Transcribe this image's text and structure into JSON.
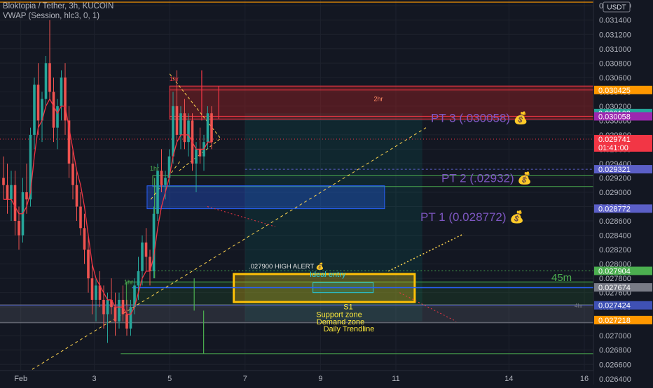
{
  "header": {
    "symbol_line": "Bloktopia / Tether, 3h, KUCOIN",
    "indicator_line": "VWAP (Session, hlc3, 0, 1)"
  },
  "chart_data": {
    "type": "candlestick",
    "title": "Bloktopia / Tether, 3h, KUCOIN",
    "ylim": [
      0.02632,
      0.03168
    ],
    "currency_label": "USDT",
    "y_ticks": [
      0.0316,
      0.0314,
      0.0312,
      0.031,
      0.0308,
      0.0306,
      0.0304,
      0.0302,
      0.03,
      0.0298,
      0.0296,
      0.0294,
      0.0292,
      0.029,
      0.0288,
      0.0286,
      0.0284,
      0.0282,
      0.028,
      0.0278,
      0.0276,
      0.0274,
      0.0272,
      0.027,
      0.0268,
      0.0266,
      0.0264
    ],
    "x_ticks": [
      {
        "label": "Feb",
        "day": 1.05
      },
      {
        "label": "3",
        "day": 3
      },
      {
        "label": "5",
        "day": 5
      },
      {
        "label": "7",
        "day": 7
      },
      {
        "label": "9",
        "day": 9
      },
      {
        "label": "11",
        "day": 11
      },
      {
        "label": "14",
        "day": 14
      },
      {
        "label": "16",
        "day": 16
      }
    ],
    "price_tags": [
      {
        "value": 0.030425,
        "label": "0.030425",
        "color": "#ff9800"
      },
      {
        "value": 0.030103,
        "label": "0.030103",
        "color": "#26a69a"
      },
      {
        "value": 0.030058,
        "label": "0.030058",
        "color": "#9c27b0"
      },
      {
        "value": 0.029741,
        "label": "0.029741",
        "sub": "01:41:00",
        "color": "#f23645"
      },
      {
        "value": 0.029321,
        "label": "0.029321",
        "color": "#5b5fc7"
      },
      {
        "value": 0.028772,
        "label": "0.028772",
        "color": "#5b5fc7"
      },
      {
        "value": 0.027904,
        "label": "0.027904",
        "color": "#4caf50"
      },
      {
        "value": 0.027674,
        "label": "0.027674",
        "color": "#787b86"
      },
      {
        "value": 0.027424,
        "label": "0.027424",
        "color": "#3f51b5"
      },
      {
        "value": 0.027218,
        "label": "0.027218",
        "color": "#ff9800"
      }
    ],
    "candles": [
      {
        "o": 0.0292,
        "h": 0.0295,
        "l": 0.0289,
        "c": 0.0291
      },
      {
        "o": 0.0291,
        "h": 0.0294,
        "l": 0.0287,
        "c": 0.0289
      },
      {
        "o": 0.0289,
        "h": 0.0293,
        "l": 0.0286,
        "c": 0.0291
      },
      {
        "o": 0.0291,
        "h": 0.0293,
        "l": 0.0284,
        "c": 0.0286
      },
      {
        "o": 0.0286,
        "h": 0.0288,
        "l": 0.0282,
        "c": 0.0284
      },
      {
        "o": 0.0284,
        "h": 0.0292,
        "l": 0.0283,
        "c": 0.029
      },
      {
        "o": 0.029,
        "h": 0.0294,
        "l": 0.0287,
        "c": 0.0289
      },
      {
        "o": 0.0289,
        "h": 0.0299,
        "l": 0.0288,
        "c": 0.0298
      },
      {
        "o": 0.0298,
        "h": 0.0306,
        "l": 0.0296,
        "c": 0.0305
      },
      {
        "o": 0.0305,
        "h": 0.0308,
        "l": 0.0298,
        "c": 0.03
      },
      {
        "o": 0.03,
        "h": 0.0304,
        "l": 0.0297,
        "c": 0.0303
      },
      {
        "o": 0.0303,
        "h": 0.0309,
        "l": 0.0302,
        "c": 0.0308
      },
      {
        "o": 0.0308,
        "h": 0.0314,
        "l": 0.0303,
        "c": 0.0304
      },
      {
        "o": 0.0304,
        "h": 0.0306,
        "l": 0.0297,
        "c": 0.0299
      },
      {
        "o": 0.0299,
        "h": 0.0303,
        "l": 0.0296,
        "c": 0.0302
      },
      {
        "o": 0.0302,
        "h": 0.0307,
        "l": 0.03,
        "c": 0.0306
      },
      {
        "o": 0.0306,
        "h": 0.0308,
        "l": 0.0298,
        "c": 0.03
      },
      {
        "o": 0.03,
        "h": 0.0302,
        "l": 0.0292,
        "c": 0.0294
      },
      {
        "o": 0.0294,
        "h": 0.0296,
        "l": 0.0289,
        "c": 0.0291
      },
      {
        "o": 0.0291,
        "h": 0.0293,
        "l": 0.0286,
        "c": 0.0288
      },
      {
        "o": 0.0288,
        "h": 0.029,
        "l": 0.0284,
        "c": 0.0285
      },
      {
        "o": 0.0285,
        "h": 0.0287,
        "l": 0.028,
        "c": 0.0282
      },
      {
        "o": 0.0282,
        "h": 0.0284,
        "l": 0.0276,
        "c": 0.0278
      },
      {
        "o": 0.0278,
        "h": 0.028,
        "l": 0.0273,
        "c": 0.0275
      },
      {
        "o": 0.0275,
        "h": 0.0278,
        "l": 0.0272,
        "c": 0.0277
      },
      {
        "o": 0.0277,
        "h": 0.0279,
        "l": 0.0274,
        "c": 0.0275
      },
      {
        "o": 0.0275,
        "h": 0.0277,
        "l": 0.0271,
        "c": 0.0273
      },
      {
        "o": 0.0273,
        "h": 0.0276,
        "l": 0.0269,
        "c": 0.0275
      },
      {
        "o": 0.0275,
        "h": 0.0278,
        "l": 0.0273,
        "c": 0.0274
      },
      {
        "o": 0.0274,
        "h": 0.0276,
        "l": 0.027,
        "c": 0.0272
      },
      {
        "o": 0.0272,
        "h": 0.0276,
        "l": 0.0271,
        "c": 0.0275
      },
      {
        "o": 0.0275,
        "h": 0.0277,
        "l": 0.0272,
        "c": 0.0273
      },
      {
        "o": 0.0273,
        "h": 0.0275,
        "l": 0.027,
        "c": 0.0271
      },
      {
        "o": 0.0271,
        "h": 0.0275,
        "l": 0.027,
        "c": 0.0274
      },
      {
        "o": 0.0274,
        "h": 0.0278,
        "l": 0.0273,
        "c": 0.0277
      },
      {
        "o": 0.0277,
        "h": 0.0281,
        "l": 0.0275,
        "c": 0.0279
      },
      {
        "o": 0.0279,
        "h": 0.0284,
        "l": 0.0277,
        "c": 0.0283
      },
      {
        "o": 0.0283,
        "h": 0.0285,
        "l": 0.0279,
        "c": 0.0281
      },
      {
        "o": 0.0281,
        "h": 0.0282,
        "l": 0.0277,
        "c": 0.0279
      },
      {
        "o": 0.0279,
        "h": 0.0288,
        "l": 0.0278,
        "c": 0.0287
      },
      {
        "o": 0.0287,
        "h": 0.0294,
        "l": 0.0286,
        "c": 0.0293
      },
      {
        "o": 0.0293,
        "h": 0.0296,
        "l": 0.029,
        "c": 0.0291
      },
      {
        "o": 0.0291,
        "h": 0.0293,
        "l": 0.0289,
        "c": 0.0292
      },
      {
        "o": 0.0292,
        "h": 0.0296,
        "l": 0.0291,
        "c": 0.0295
      },
      {
        "o": 0.0295,
        "h": 0.0304,
        "l": 0.0294,
        "c": 0.0302
      },
      {
        "o": 0.0302,
        "h": 0.0307,
        "l": 0.0297,
        "c": 0.0298
      },
      {
        "o": 0.0298,
        "h": 0.0302,
        "l": 0.0296,
        "c": 0.0301
      },
      {
        "o": 0.0301,
        "h": 0.0303,
        "l": 0.0296,
        "c": 0.0297
      },
      {
        "o": 0.0297,
        "h": 0.0301,
        "l": 0.0295,
        "c": 0.03
      },
      {
        "o": 0.03,
        "h": 0.0301,
        "l": 0.0293,
        "c": 0.0294
      },
      {
        "o": 0.0294,
        "h": 0.0297,
        "l": 0.029,
        "c": 0.0296
      },
      {
        "o": 0.0296,
        "h": 0.0299,
        "l": 0.0294,
        "c": 0.0295
      },
      {
        "o": 0.0295,
        "h": 0.0298,
        "l": 0.0293,
        "c": 0.0297
      },
      {
        "o": 0.0297,
        "h": 0.0302,
        "l": 0.0296,
        "c": 0.0301
      },
      {
        "o": 0.0301,
        "h": 0.0302,
        "l": 0.0296,
        "c": 0.0297
      }
    ],
    "vwap_line": [
      0.0289,
      0.0289,
      0.0289,
      0.0288,
      0.0287,
      0.0287,
      0.0288,
      0.029,
      0.0295,
      0.0299,
      0.03,
      0.0302,
      0.0303,
      0.0302,
      0.0301,
      0.0302,
      0.0302,
      0.0299,
      0.0296,
      0.0293,
      0.0291,
      0.0288,
      0.0284,
      0.028,
      0.0278,
      0.0277,
      0.0276,
      0.0275,
      0.0275,
      0.0274,
      0.0274,
      0.0274,
      0.0273,
      0.0273,
      0.0274,
      0.0276,
      0.0278,
      0.0279,
      0.0279,
      0.0281,
      0.0285,
      0.0288,
      0.029,
      0.0292,
      0.0295,
      0.0297,
      0.0298,
      0.0298,
      0.0298,
      0.0297,
      0.0296,
      0.0296,
      0.0296,
      0.0297,
      0.0297
    ],
    "zones": [
      {
        "name": "zone-2hr",
        "top": 0.03048,
        "bottom": 0.03002,
        "left_day": 5.0,
        "right_day": 17,
        "fill": "rgba(178,34,34,0.38)",
        "stroke": "#f23645",
        "label": "2hr"
      },
      {
        "name": "zone-1hr-green",
        "top": 0.02923,
        "bottom": 0.02908,
        "left_day": 4.55,
        "right_day": 17,
        "fill": "rgba(0,0,0,0)",
        "stroke": "#4caf50"
      },
      {
        "name": "zone-blue-box",
        "top": 0.02909,
        "bottom": 0.02877,
        "left_day": 4.4,
        "right_day": 10.7,
        "fill": "rgba(41,98,255,0.32)",
        "stroke": "#2962ff"
      },
      {
        "name": "zone-support",
        "top": 0.02775,
        "bottom": 0.02743,
        "left_day": 3.85,
        "right_day": 17,
        "fill": "rgba(46,125,50,0.18)",
        "stroke": "#4caf50"
      },
      {
        "name": "zone-ideal-entry",
        "top": 0.02786,
        "bottom": 0.02747,
        "left_day": 6.7,
        "right_day": 11.5,
        "fill": "rgba(255,193,7,0.28)",
        "stroke": "#ffc107",
        "label": "Ideal entry"
      },
      {
        "name": "zone-demand",
        "top": 0.02743,
        "bottom": 0.02718,
        "left_day": 0.4,
        "right_day": 17,
        "fill": "rgba(120,123,134,0.22)",
        "stroke": "#787b86"
      }
    ],
    "target_box": {
      "top": 0.0301,
      "bottom": 0.0272,
      "left_day": 7.0,
      "right_day": 11.7
    },
    "annotations": {
      "pt3": "PT 3 (.030058) 💰",
      "pt2": "PT 2 (.02932) 💰",
      "pt1": "PT 1 (0.028772) 💰",
      "high_alert": ".027900 HIGH ALERT 💰",
      "ideal_entry": "Ideal entry",
      "s1": "S1",
      "support": "Support zone",
      "demand": "Demand zone",
      "trendline": "Daily Trendline",
      "tf_45m": "45m",
      "tf_2hr": "2hr",
      "tf_1hr_top": "1hr",
      "tf_1hr_mid": "1hr",
      "tf_1hr_low": "1hr",
      "tf_4hr": "4hr"
    }
  }
}
